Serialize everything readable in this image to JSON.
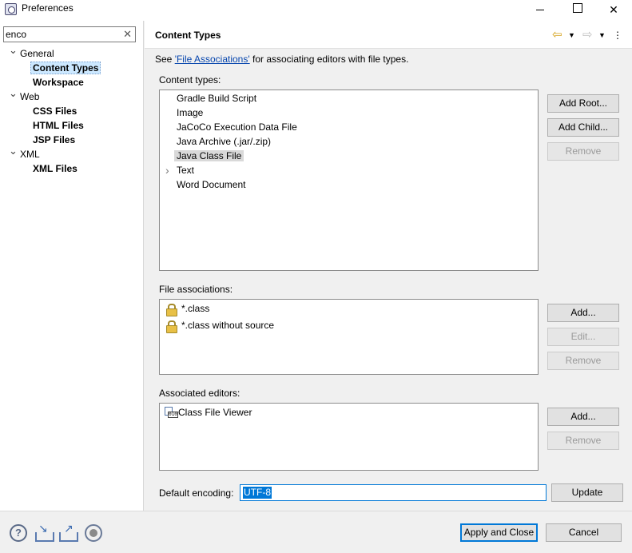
{
  "window": {
    "title": "Preferences",
    "icon": "eclipse-icon"
  },
  "sidebar": {
    "filter": {
      "value": "enco",
      "clear_glyph": "✕"
    },
    "tree": [
      {
        "label": "General",
        "level": 0,
        "expanded": true,
        "bold": false,
        "selected": false
      },
      {
        "label": "Content Types",
        "level": 1,
        "bold": true,
        "selected": true
      },
      {
        "label": "Workspace",
        "level": 1,
        "bold": true,
        "selected": false
      },
      {
        "label": "Web",
        "level": 0,
        "expanded": true,
        "bold": false,
        "selected": false
      },
      {
        "label": "CSS Files",
        "level": 1,
        "bold": true,
        "selected": false
      },
      {
        "label": "HTML Files",
        "level": 1,
        "bold": true,
        "selected": false
      },
      {
        "label": "JSP Files",
        "level": 1,
        "bold": true,
        "selected": false
      },
      {
        "label": "XML",
        "level": 0,
        "expanded": true,
        "bold": false,
        "selected": false
      },
      {
        "label": "XML Files",
        "level": 1,
        "bold": true,
        "selected": false
      }
    ]
  },
  "main": {
    "title": "Content Types",
    "description": {
      "prefix": "See ",
      "link": "'File Associations'",
      "suffix": " for associating editors with file types."
    },
    "content_types": {
      "label": "Content types:",
      "items": [
        {
          "label": "Gradle Build Script",
          "expandable": false,
          "selected": false
        },
        {
          "label": "Image",
          "expandable": false,
          "selected": false
        },
        {
          "label": "JaCoCo Execution Data File",
          "expandable": false,
          "selected": false
        },
        {
          "label": "Java Archive (.jar/.zip)",
          "expandable": false,
          "selected": false
        },
        {
          "label": "Java Class File",
          "expandable": false,
          "selected": true
        },
        {
          "label": "Text",
          "expandable": true,
          "selected": false
        },
        {
          "label": "Word Document",
          "expandable": false,
          "selected": false
        }
      ],
      "buttons": {
        "add_root": "Add Root...",
        "add_child": "Add Child...",
        "remove": "Remove"
      }
    },
    "file_associations": {
      "label": "File associations:",
      "items": [
        {
          "label": "*.class",
          "icon": "lock-icon"
        },
        {
          "label": "*.class without source",
          "icon": "lock-icon"
        }
      ],
      "buttons": {
        "add": "Add...",
        "edit": "Edit...",
        "remove": "Remove"
      }
    },
    "associated_editors": {
      "label": "Associated editors:",
      "items": [
        {
          "label": "Class File Viewer",
          "icon": "binary-file-icon",
          "icon_text": "010"
        }
      ],
      "buttons": {
        "add": "Add...",
        "remove": "Remove"
      }
    },
    "encoding": {
      "label": "Default encoding:",
      "value": "UTF-8",
      "update_label": "Update"
    }
  },
  "footer": {
    "apply_close": "Apply and Close",
    "cancel": "Cancel"
  },
  "colors": {
    "selection": "#cce8ff",
    "accent": "#0078d7",
    "link": "#0645ad"
  }
}
